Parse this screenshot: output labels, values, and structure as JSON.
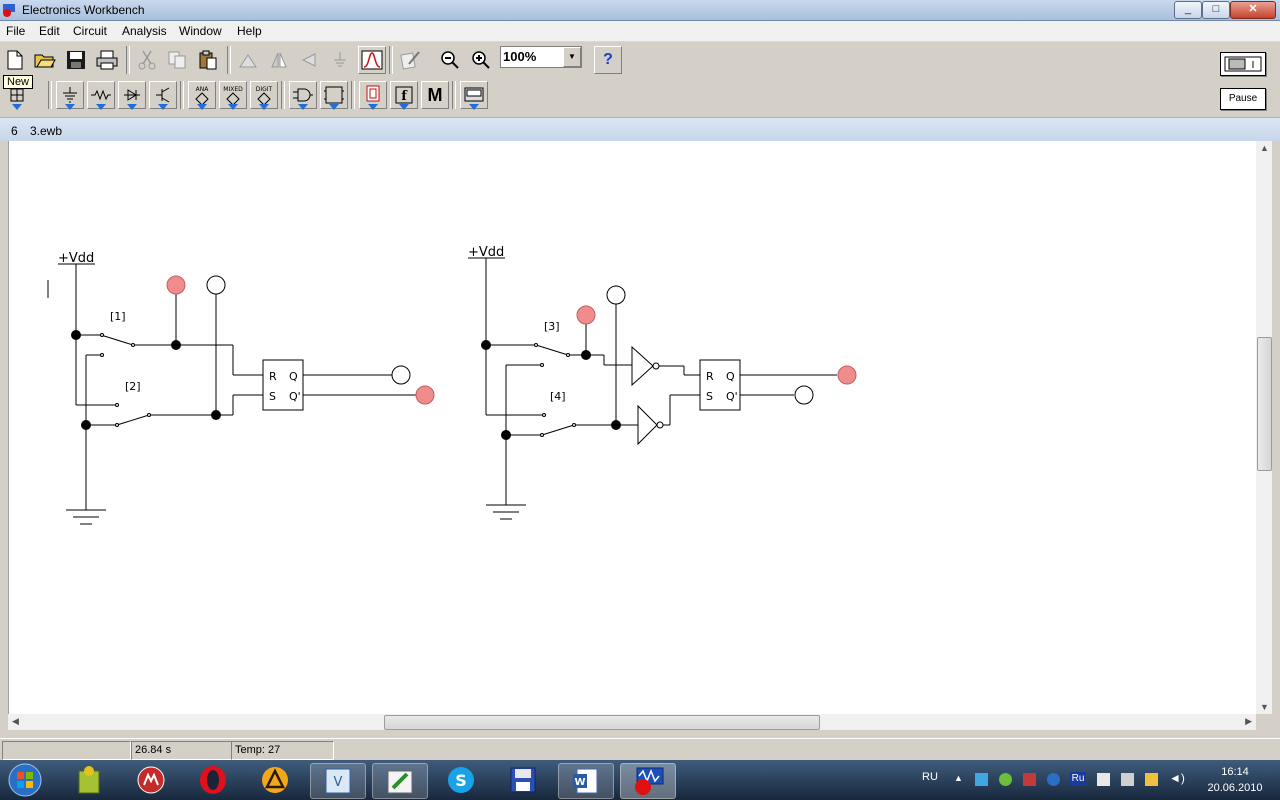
{
  "window": {
    "title": "Electronics Workbench",
    "controls": [
      "_",
      "□",
      "✕"
    ]
  },
  "menu": [
    "File",
    "Edit",
    "Circuit",
    "Analysis",
    "Window",
    "Help"
  ],
  "toolbar": {
    "zoom": "100%",
    "help_label": "?",
    "tooltip": "New",
    "pause_label": "Pause",
    "parts_labels": {
      "ana": "ANA",
      "mixed": "MIXED",
      "digit": "DIGIT",
      "m": "M"
    }
  },
  "document": {
    "number": "6",
    "filename": "3.ewb"
  },
  "circuit": {
    "left": {
      "vdd_label": "+Vdd",
      "switch_a": "[1]",
      "switch_b": "[2]"
    },
    "right": {
      "vdd_label": "+Vdd",
      "switch_a": "[3]",
      "switch_b": "[4]"
    },
    "flipflop": {
      "r": "R",
      "s": "S",
      "q": "Q",
      "qbar": "Q'"
    },
    "probe_on_color": "#f08c8c",
    "probe_off_color": "#ffffff"
  },
  "status": {
    "time": "26.84 s",
    "temp": "Temp:  27"
  },
  "taskbar": {
    "language": "RU",
    "tray_lang": "Ru",
    "time": "16:14",
    "date": "20.06.2010",
    "apps": [
      "start-orb",
      "app-puzzle",
      "app-security",
      "app-opera",
      "app-triangle",
      "app-visio",
      "app-paint",
      "app-skype",
      "app-floppy",
      "app-word",
      "app-workbench"
    ]
  }
}
